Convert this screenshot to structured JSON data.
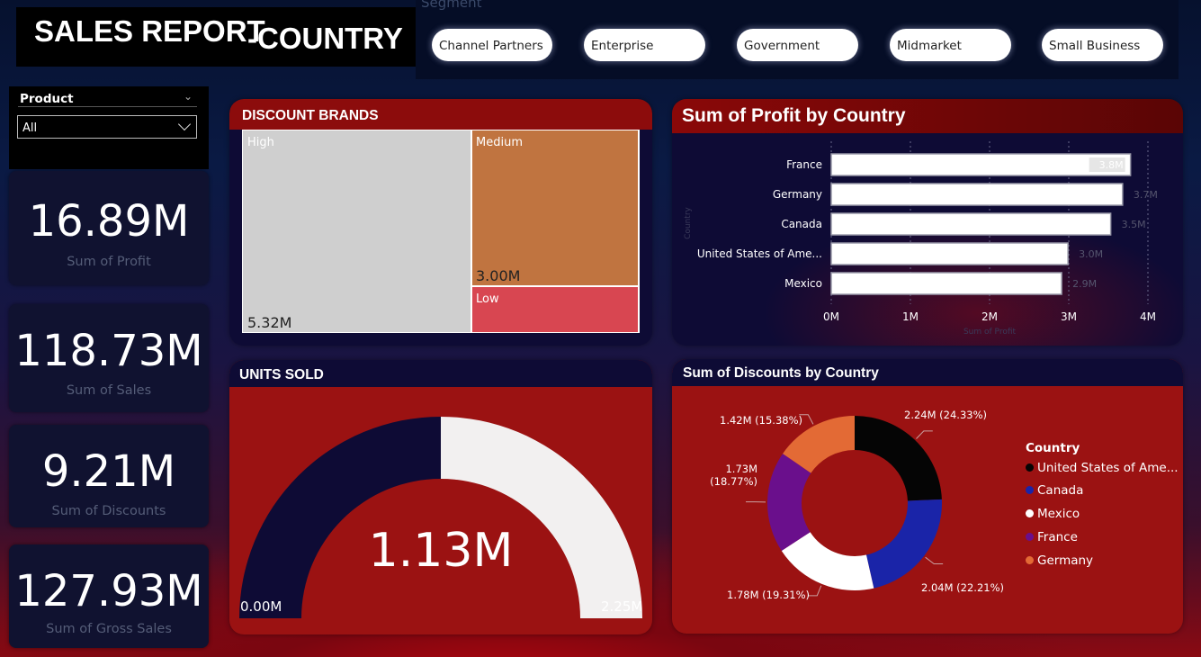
{
  "header": {
    "title_main": "SALES REPORT",
    "title_country": "-COUNTRY"
  },
  "segment": {
    "label": "Segment",
    "options": [
      "Channel Partners",
      "Enterprise",
      "Government",
      "Midmarket",
      "Small Business"
    ]
  },
  "product": {
    "label": "Product",
    "selected": "All"
  },
  "kpis": [
    {
      "value": "16.89M",
      "label": "Sum of Profit"
    },
    {
      "value": "118.73M",
      "label": "Sum of  Sales"
    },
    {
      "value": "9.21M",
      "label": "Sum of Discounts"
    },
    {
      "value": "127.93M",
      "label": "Sum of Gross Sales"
    }
  ],
  "treemap": {
    "title": "DISCOUNT BRANDS",
    "cells": [
      {
        "name": "High",
        "value_label": "5.32M",
        "color": "#cfcfcf"
      },
      {
        "name": "Medium",
        "value_label": "3.00M",
        "color": "#c07440"
      },
      {
        "name": "Low",
        "value_label": "",
        "color": "#d84651"
      }
    ]
  },
  "gauge": {
    "title": "UNITS SOLD",
    "value_label": "1.13M",
    "min_label": "0.00M",
    "max_label": "2.25M",
    "fraction": 0.5
  },
  "colors": {
    "card_red": "#9b1212",
    "card_head_dark": "#0e0b35",
    "gauge_fill": "#0e0b35",
    "gauge_track": "#f2f0f0"
  },
  "chart_data": [
    {
      "type": "bar",
      "orientation": "horizontal",
      "title": "Sum of Profit by Country",
      "xlabel": "Sum of Profit",
      "ylabel": "Country",
      "categories": [
        "France",
        "Germany",
        "Canada",
        "United States of Ame...",
        "Mexico"
      ],
      "values": [
        3.78,
        3.68,
        3.53,
        2.99,
        2.91
      ],
      "data_labels": [
        "3.8M",
        "3.7M",
        "3.5M",
        "3.0M",
        "2.9M"
      ],
      "xlim": [
        0,
        4
      ],
      "xticks": [
        "0M",
        "1M",
        "2M",
        "3M",
        "4M"
      ],
      "grid": true
    },
    {
      "type": "pie",
      "donut": true,
      "title": "Sum of Discounts by Country",
      "legend_title": "Country",
      "legend_position": "right",
      "slices": [
        {
          "name": "United States of Ame...",
          "value": 2.24,
          "label": "2.24M (24.33%)",
          "color": "#050505"
        },
        {
          "name": "Canada",
          "value": 2.04,
          "label": "2.04M (22.21%)",
          "color": "#1a24a8"
        },
        {
          "name": "Mexico",
          "value": 1.78,
          "label": "1.78M (19.31%)",
          "color": "#ffffff"
        },
        {
          "name": "France",
          "value": 1.73,
          "label": "1.73M (18.77%)",
          "color": "#6a0f8c"
        },
        {
          "name": "Germany",
          "value": 1.42,
          "label": "1.42M (15.38%)",
          "color": "#e36a35"
        }
      ]
    }
  ]
}
